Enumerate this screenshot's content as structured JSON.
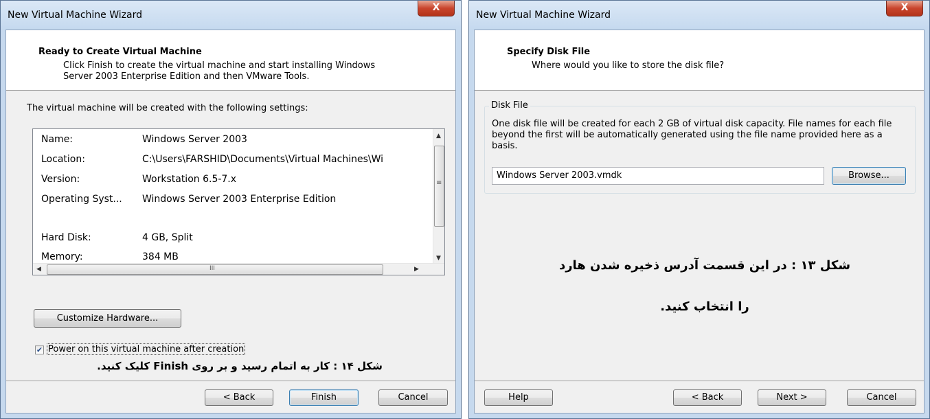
{
  "left": {
    "window_title": "New Virtual Machine Wizard",
    "close_glyph": "X",
    "header_title": "Ready to Create Virtual Machine",
    "header_line1": "Click Finish to create the virtual machine and start installing Windows",
    "header_line2": "Server 2003 Enterprise Edition and then VMware Tools.",
    "intro": "The virtual machine will be created with the following settings:",
    "settings": [
      {
        "key": "Name:",
        "value": "Windows Server 2003"
      },
      {
        "key": "Location:",
        "value": "C:\\Users\\FARSHID\\Documents\\Virtual Machines\\Wi"
      },
      {
        "key": "Version:",
        "value": "Workstation 6.5-7.x"
      },
      {
        "key": "Operating Syst...",
        "value": "Windows Server 2003 Enterprise Edition"
      },
      {
        "key": "Hard Disk:",
        "value": "4 GB, Split"
      },
      {
        "key": "Memory:",
        "value": "384 MB"
      }
    ],
    "scroll_grip": "≡",
    "hscroll_grip": "III",
    "customize_label": "Customize Hardware...",
    "power_on_label": "Power on this virtual machine after creation",
    "power_on_checked": true,
    "caption": "شکل ۱۴ : کار به اتمام رسید و بر روی Finish کلیک کنید.",
    "back_label": "< Back",
    "finish_label": "Finish",
    "cancel_label": "Cancel"
  },
  "right": {
    "window_title": "New Virtual Machine Wizard",
    "close_glyph": "X",
    "header_title": "Specify Disk File",
    "header_sub": "Where would you like to store the disk file?",
    "group_title": "Disk File",
    "group_text": "One disk file will be created for each 2 GB of virtual disk capacity. File names for each file beyond the first will be automatically generated using the file name provided here as a basis.",
    "file_value": "Windows Server 2003.vmdk",
    "browse_label": "Browse...",
    "caption_line1": "شکل ۱۳ : در این قسمت آدرس ذخیره شدن هارد",
    "caption_line2": "را انتخاب کنید.",
    "help_label": "Help",
    "back_label": "< Back",
    "next_label": "Next >",
    "cancel_label": "Cancel"
  }
}
